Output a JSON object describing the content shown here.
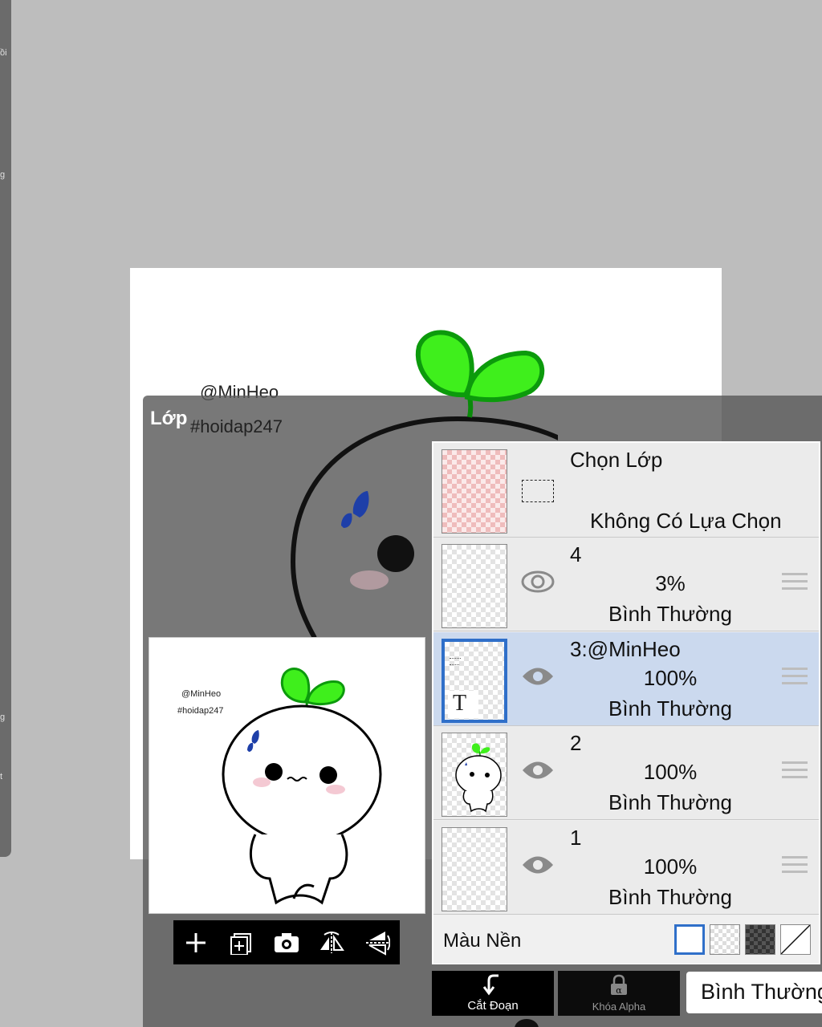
{
  "side_strip": {
    "fragments": [
      "ồi",
      "g",
      "g",
      "t"
    ]
  },
  "canvas": {
    "watermark_line1": "@MinHeo",
    "watermark_line2": "#hoidap247"
  },
  "overlay": {
    "title": "Lớp"
  },
  "preview": {
    "watermark_line1": "@MinHeo",
    "watermark_line2": "#hoidap247"
  },
  "layer_toolbar": {
    "icons": [
      "add-layer-icon",
      "add-layer-image-icon",
      "camera-icon",
      "flip-horizontal-icon",
      "flip-vertical-icon"
    ]
  },
  "layers_panel": {
    "selection_row": {
      "title": "Chọn Lớp",
      "status": "Không Có Lựa Chọn"
    },
    "layers": [
      {
        "name": "4",
        "opacity": "3%",
        "mode": "Bình Thường",
        "visible": true,
        "selected": false
      },
      {
        "name": "3:@MinHeo",
        "opacity": "100%",
        "mode": "Bình Thường",
        "visible": true,
        "selected": true,
        "thumb_glyph": "T"
      },
      {
        "name": "2",
        "opacity": "100%",
        "mode": "Bình Thường",
        "visible": true,
        "selected": false
      },
      {
        "name": "1",
        "opacity": "100%",
        "mode": "Bình Thường",
        "visible": true,
        "selected": false
      }
    ],
    "background_color": {
      "label": "Màu Nền",
      "options": [
        "white",
        "transparent",
        "dark-checker",
        "none"
      ],
      "selected": "white"
    }
  },
  "bottom_bar": {
    "clipping_label": "Cắt Đoạn",
    "alpha_lock_label": "Khóa Alpha",
    "blend_mode": "Bình Thường"
  },
  "colors": {
    "selected_row": "#cbd9ee",
    "selection_border": "#2f6fc9",
    "sprout_green": "#33ee11"
  }
}
